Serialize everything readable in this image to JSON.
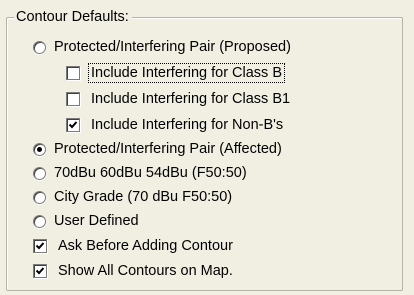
{
  "group": {
    "title": "Contour Defaults:"
  },
  "options": {
    "proposed": {
      "label": "Protected/Interfering Pair (Proposed)",
      "checked": false
    },
    "class_b": {
      "label": "Include Interfering for Class B",
      "checked": false
    },
    "class_b1": {
      "label": "Include Interfering for Class B1",
      "checked": false
    },
    "non_b": {
      "label": "Include Interfering for Non-B's",
      "checked": true
    },
    "affected": {
      "label": "Protected/Interfering Pair (Affected)",
      "checked": true
    },
    "dbu_70_60_54": {
      "label": "70dBu 60dBu 54dBu (F50:50)",
      "checked": false
    },
    "city_grade": {
      "label": "City Grade (70 dBu F50:50)",
      "checked": false
    },
    "user_defined": {
      "label": "User Defined",
      "checked": false
    },
    "ask_before": {
      "label": "Ask Before Adding Contour",
      "checked": true
    },
    "show_all": {
      "label": "Show All Contours on Map.",
      "checked": true
    }
  },
  "icons": {
    "check": "check-mark-icon",
    "radio_dot": "radio-dot-icon"
  }
}
